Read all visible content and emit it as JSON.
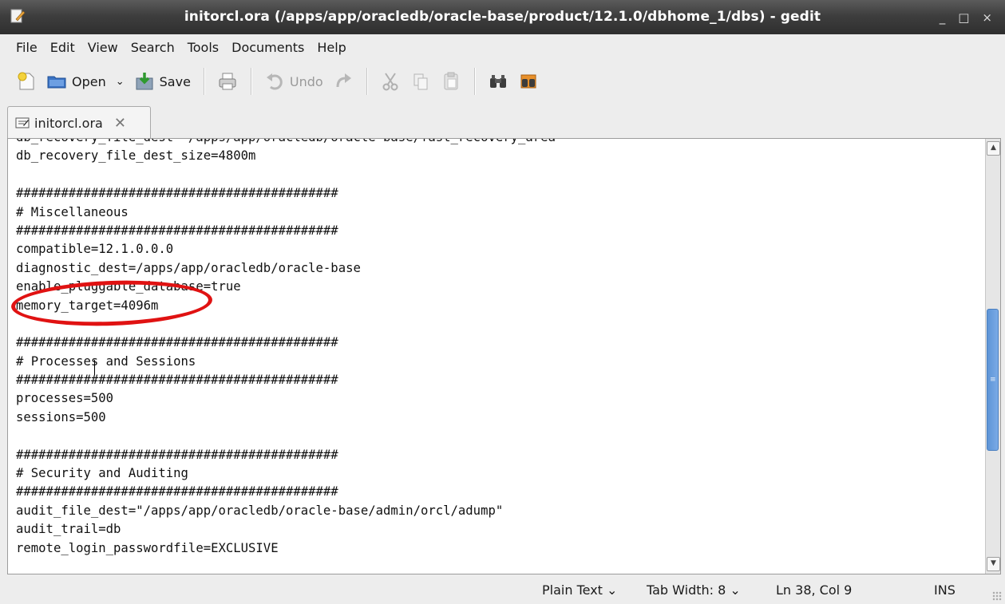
{
  "window": {
    "title": "initorcl.ora (/apps/app/oracledb/oracle-base/product/12.1.0/dbhome_1/dbs) - gedit",
    "controls": [
      "_",
      "□",
      "×"
    ]
  },
  "menubar": {
    "items": [
      "File",
      "Edit",
      "View",
      "Search",
      "Tools",
      "Documents",
      "Help"
    ]
  },
  "toolbar": {
    "open_label": "Open",
    "save_label": "Save",
    "undo_label": "Undo"
  },
  "tab": {
    "label": "initorcl.ora",
    "close": "✕"
  },
  "editor": {
    "lines": [
      "db_recovery_file_dest='/apps/app/oracledb/oracle-base/fast_recovery_area'",
      "db_recovery_file_dest_size=4800m",
      "",
      "###########################################",
      "# Miscellaneous",
      "###########################################",
      "compatible=12.1.0.0.0",
      "diagnostic_dest=/apps/app/oracledb/oracle-base",
      "enable_pluggable_database=true",
      "memory_target=4096m",
      "",
      "###########################################",
      "# Processes and Sessions",
      "###########################################",
      "processes=500",
      "sessions=500",
      "",
      "###########################################",
      "# Security and Auditing",
      "###########################################",
      "audit_file_dest=\"/apps/app/oracledb/oracle-base/admin/orcl/adump\"",
      "audit_trail=db",
      "remote_login_passwordfile=EXCLUSIVE"
    ],
    "highlight_color": "#e01212",
    "scroll_position": 0.52
  },
  "statusbar": {
    "language": "Plain Text ⌄",
    "tab_width": "Tab Width:  8 ⌄",
    "position": "Ln 38, Col 9",
    "mode": "INS"
  }
}
